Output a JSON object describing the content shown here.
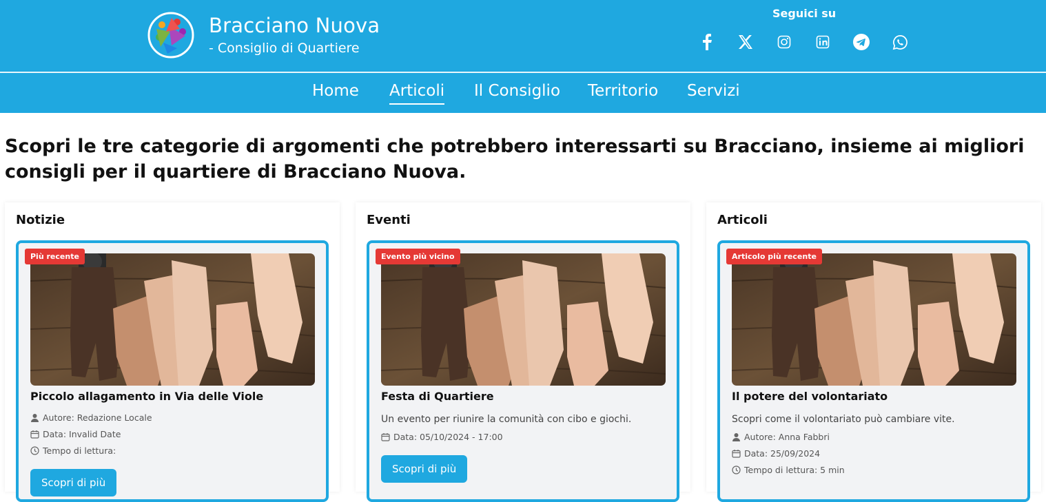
{
  "header": {
    "title": "Bracciano Nuova",
    "subtitle": "- Consiglio di Quartiere",
    "follow_label": "Seguici su",
    "social_icons": [
      "facebook-icon",
      "x-icon",
      "instagram-icon",
      "linkedin-icon",
      "telegram-icon",
      "whatsapp-icon"
    ]
  },
  "nav": {
    "items": [
      "Home",
      "Articoli",
      "Il Consiglio",
      "Territorio",
      "Servizi"
    ],
    "active": "Articoli"
  },
  "main": {
    "heading": "Scopri le tre categorie di argomenti che potrebbero interessarti su Bracciano, insieme ai migliori consigli per il quartiere di Bracciano Nuova."
  },
  "columns": [
    {
      "title": "Notizie",
      "card": {
        "badge": "Più recente",
        "title": "Piccolo allagamento in Via delle Viole",
        "author": "Autore: Redazione Locale",
        "date": "Data: Invalid Date",
        "reading": "Tempo di lettura:",
        "button": "Scopri di più"
      }
    },
    {
      "title": "Eventi",
      "card": {
        "badge": "Evento più vicino",
        "title": "Festa di Quartiere",
        "description": "Un evento per riunire la comunità con cibo e giochi.",
        "date": "Data: 05/10/2024 - 17:00",
        "button": "Scopri di più"
      }
    },
    {
      "title": "Articoli",
      "card": {
        "badge": "Articolo più recente",
        "title": "Il potere del volontariato",
        "description": "Scopri come il volontariato può cambiare vite.",
        "author": "Autore: Anna Fabbri",
        "date": "Data: 25/09/2024",
        "reading": "Tempo di lettura: 5 min"
      }
    }
  ],
  "colors": {
    "brand": "#1fa8e0",
    "badge": "#e53935",
    "card_background": "#f2f3f5"
  }
}
